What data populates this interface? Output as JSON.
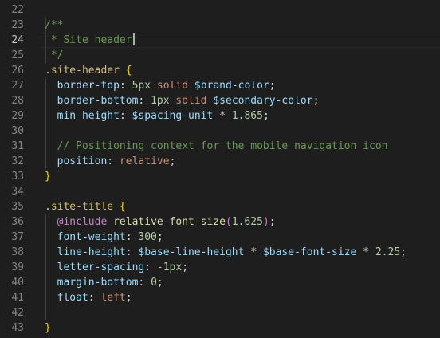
{
  "editor": {
    "active_line": "24",
    "lines": [
      {
        "num": "22",
        "tokens": []
      },
      {
        "num": "23",
        "tokens": [
          {
            "t": "comment",
            "v": "/**"
          }
        ]
      },
      {
        "num": "24",
        "tokens": [
          {
            "t": "comment",
            "v": " * Site header"
          }
        ],
        "cursor": true
      },
      {
        "num": "25",
        "tokens": [
          {
            "t": "comment",
            "v": " */"
          }
        ]
      },
      {
        "num": "26",
        "tokens": [
          {
            "t": "selector",
            "v": ".site-header"
          },
          {
            "t": "punct",
            "v": " "
          },
          {
            "t": "brace",
            "v": "{"
          }
        ]
      },
      {
        "num": "27",
        "tokens": [
          {
            "t": "punct",
            "v": "  "
          },
          {
            "t": "prop",
            "v": "border-top"
          },
          {
            "t": "punct",
            "v": ": "
          },
          {
            "t": "num",
            "v": "5px"
          },
          {
            "t": "punct",
            "v": " "
          },
          {
            "t": "val",
            "v": "solid"
          },
          {
            "t": "punct",
            "v": " "
          },
          {
            "t": "var",
            "v": "$brand-color"
          },
          {
            "t": "punct",
            "v": ";"
          }
        ]
      },
      {
        "num": "28",
        "tokens": [
          {
            "t": "punct",
            "v": "  "
          },
          {
            "t": "prop",
            "v": "border-bottom"
          },
          {
            "t": "punct",
            "v": ": "
          },
          {
            "t": "num",
            "v": "1px"
          },
          {
            "t": "punct",
            "v": " "
          },
          {
            "t": "val",
            "v": "solid"
          },
          {
            "t": "punct",
            "v": " "
          },
          {
            "t": "var",
            "v": "$secondary-color"
          },
          {
            "t": "punct",
            "v": ";"
          }
        ]
      },
      {
        "num": "29",
        "tokens": [
          {
            "t": "punct",
            "v": "  "
          },
          {
            "t": "prop",
            "v": "min-height"
          },
          {
            "t": "punct",
            "v": ": "
          },
          {
            "t": "var",
            "v": "$spacing-unit"
          },
          {
            "t": "op",
            "v": " * "
          },
          {
            "t": "num",
            "v": "1.865"
          },
          {
            "t": "punct",
            "v": ";"
          }
        ]
      },
      {
        "num": "30",
        "tokens": []
      },
      {
        "num": "31",
        "tokens": [
          {
            "t": "punct",
            "v": "  "
          },
          {
            "t": "comment",
            "v": "// Positioning context for the mobile navigation icon"
          }
        ]
      },
      {
        "num": "32",
        "tokens": [
          {
            "t": "punct",
            "v": "  "
          },
          {
            "t": "prop",
            "v": "position"
          },
          {
            "t": "punct",
            "v": ": "
          },
          {
            "t": "val",
            "v": "relative"
          },
          {
            "t": "punct",
            "v": ";"
          }
        ]
      },
      {
        "num": "33",
        "tokens": [
          {
            "t": "brace",
            "v": "}"
          }
        ]
      },
      {
        "num": "34",
        "tokens": []
      },
      {
        "num": "35",
        "tokens": [
          {
            "t": "selector",
            "v": ".site-title"
          },
          {
            "t": "punct",
            "v": " "
          },
          {
            "t": "brace",
            "v": "{"
          }
        ]
      },
      {
        "num": "36",
        "tokens": [
          {
            "t": "punct",
            "v": "  "
          },
          {
            "t": "atrule",
            "v": "@include"
          },
          {
            "t": "punct",
            "v": " "
          },
          {
            "t": "func",
            "v": "relative-font-size"
          },
          {
            "t": "paren",
            "v": "("
          },
          {
            "t": "num",
            "v": "1.625"
          },
          {
            "t": "paren",
            "v": ")"
          },
          {
            "t": "punct",
            "v": ";"
          }
        ]
      },
      {
        "num": "37",
        "tokens": [
          {
            "t": "punct",
            "v": "  "
          },
          {
            "t": "prop",
            "v": "font-weight"
          },
          {
            "t": "punct",
            "v": ": "
          },
          {
            "t": "num",
            "v": "300"
          },
          {
            "t": "punct",
            "v": ";"
          }
        ]
      },
      {
        "num": "38",
        "tokens": [
          {
            "t": "punct",
            "v": "  "
          },
          {
            "t": "prop",
            "v": "line-height"
          },
          {
            "t": "punct",
            "v": ": "
          },
          {
            "t": "var",
            "v": "$base-line-height"
          },
          {
            "t": "op",
            "v": " * "
          },
          {
            "t": "var",
            "v": "$base-font-size"
          },
          {
            "t": "op",
            "v": " * "
          },
          {
            "t": "num",
            "v": "2.25"
          },
          {
            "t": "punct",
            "v": ";"
          }
        ]
      },
      {
        "num": "39",
        "tokens": [
          {
            "t": "punct",
            "v": "  "
          },
          {
            "t": "prop",
            "v": "letter-spacing"
          },
          {
            "t": "punct",
            "v": ": "
          },
          {
            "t": "num",
            "v": "-1px"
          },
          {
            "t": "punct",
            "v": ";"
          }
        ]
      },
      {
        "num": "40",
        "tokens": [
          {
            "t": "punct",
            "v": "  "
          },
          {
            "t": "prop",
            "v": "margin-bottom"
          },
          {
            "t": "punct",
            "v": ": "
          },
          {
            "t": "num",
            "v": "0"
          },
          {
            "t": "punct",
            "v": ";"
          }
        ]
      },
      {
        "num": "41",
        "tokens": [
          {
            "t": "punct",
            "v": "  "
          },
          {
            "t": "prop",
            "v": "float"
          },
          {
            "t": "punct",
            "v": ": "
          },
          {
            "t": "val",
            "v": "left"
          },
          {
            "t": "punct",
            "v": ";"
          }
        ]
      },
      {
        "num": "42",
        "tokens": []
      },
      {
        "num": "43",
        "tokens": [
          {
            "t": "brace",
            "v": "}"
          }
        ]
      }
    ]
  },
  "colors": {
    "background": "#1e1e1e",
    "comment": "#6a9955",
    "selector": "#d7ba7d",
    "brace": "#ffd700",
    "property": "#9cdcfe",
    "number": "#b5cea8",
    "string_value": "#ce9178",
    "at_rule": "#c586c0",
    "function": "#dcdcaa",
    "line_number": "#858585"
  }
}
